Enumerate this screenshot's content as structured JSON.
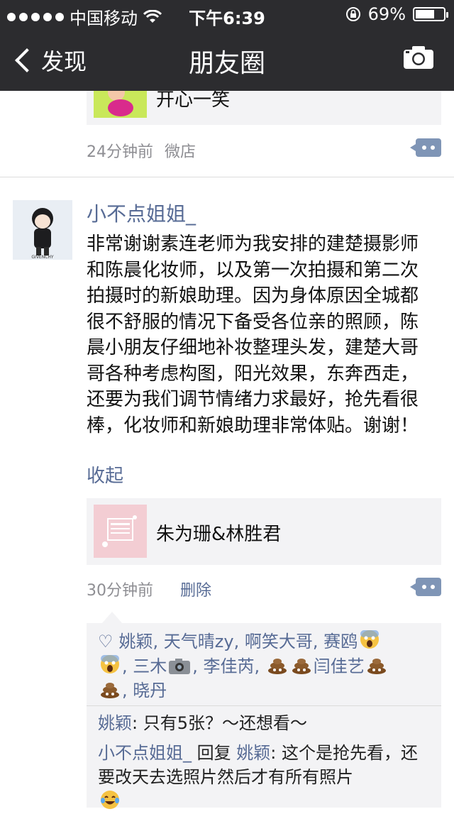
{
  "status_bar": {
    "carrier": "中国移动",
    "time": "下午6:39",
    "battery": "69%",
    "battery_level": 0.69
  },
  "nav": {
    "back_label": "发现",
    "title": "朋友圈",
    "camera_icon": "camera-icon"
  },
  "prev_post": {
    "link_title": "开心一笑",
    "time": "24分钟前",
    "source": "微店"
  },
  "post": {
    "author": "小不点姐姐_",
    "avatar_text": "GIVENCHY",
    "text": "非常谢谢素连老师为我安排的建楚摄影师和陈晨化妆师，以及第一次拍摄和第二次拍摄时的新娘助理。因为身体原因全城都很不舒服的情况下备受各位亲的照顾，陈晨小朋友仔细地补妆整理头发，建楚大哥哥各种考虑构图，阳光效果，东奔西走，还要为我们调节情绪力求最好，抢先看很棒，化妆师和新娘助理非常体贴。谢谢！",
    "collapse_label": "收起",
    "link_title": "朱为珊&林胜君",
    "time": "30分钟前",
    "delete_label": "删除"
  },
  "likes": [
    "姚颖",
    "天气晴zy",
    "啊笑大哥",
    "赛鸥",
    "三木",
    "李佳芮",
    "闫佳艺",
    "晓丹"
  ],
  "comments": {
    "c1_user": "姚颖",
    "c1_text": ": 只有5张？～还想看～",
    "c2_user": "小不点姐姐_",
    "c2_reply_word": " 回复 ",
    "c2_target": "姚颖",
    "c2_text": ": 这个是抢先看，还要改天去选照片然后才有所有照片"
  },
  "colors": {
    "nav_bg": "#2c2c2f",
    "link_blue": "#576b95",
    "meta_gray": "#8e8e93",
    "card_bg": "#f3f3f5"
  }
}
